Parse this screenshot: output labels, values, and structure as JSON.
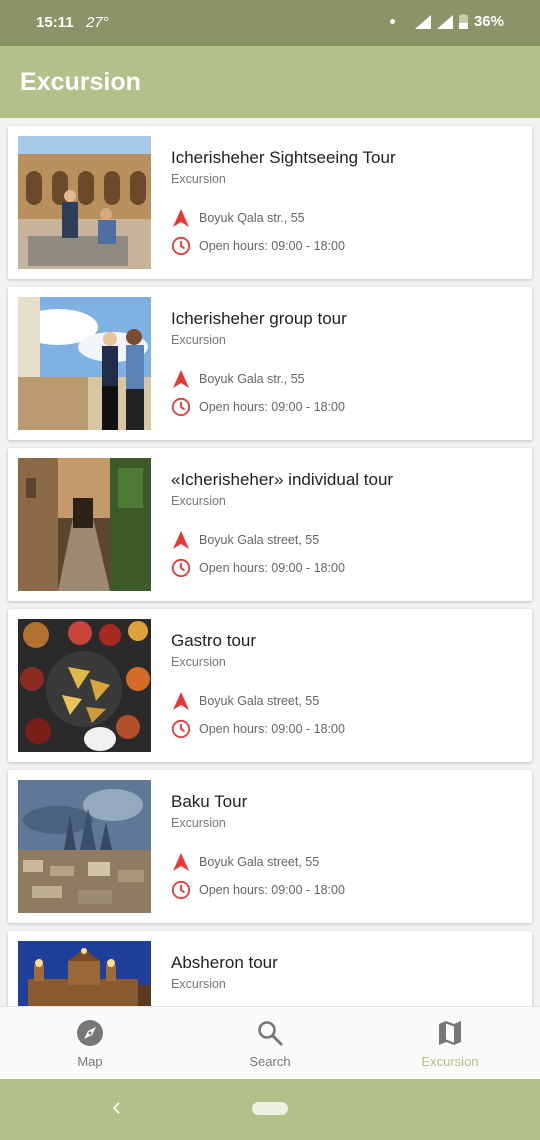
{
  "status_bar": {
    "time": "15:11",
    "temperature": "27°",
    "battery": "36%"
  },
  "app_bar": {
    "title": "Excursion"
  },
  "tours": [
    {
      "title": "Icherisheher Sightseeing Tour",
      "category": "Excursion",
      "address": "Boyuk Qala str., 55",
      "hours": "Open hours: 09:00 - 18:00",
      "image": "old-city-courtyard"
    },
    {
      "title": "Icherisheher group tour",
      "category": "Excursion",
      "address": "Boyuk Gala str., 55",
      "hours": "Open hours: 09:00 - 18:00",
      "image": "tourists-sky"
    },
    {
      "title": "«Icherisheher» individual tour",
      "category": "Excursion",
      "address": "Boyuk Gala street, 55",
      "hours": "Open hours: 09:00 - 18:00",
      "image": "narrow-street"
    },
    {
      "title": "Gastro tour",
      "category": "Excursion",
      "address": "Boyuk Gala street, 55",
      "hours": "Open hours: 09:00 - 18:00",
      "image": "sweets-table"
    },
    {
      "title": "Baku Tour",
      "category": "Excursion",
      "address": "Boyuk Gala street, 55",
      "hours": "Open hours: 09:00 - 18:00",
      "image": "city-skyline"
    },
    {
      "title": "Absheron tour",
      "category": "Excursion",
      "image": "fortress-night"
    }
  ],
  "bottom_nav": [
    {
      "label": "Map",
      "icon": "compass-icon",
      "active": false
    },
    {
      "label": "Search",
      "icon": "search-icon",
      "active": false
    },
    {
      "label": "Excursion",
      "icon": "map-icon",
      "active": true
    }
  ],
  "colors": {
    "accent": "#b4c089",
    "status_bar": "#8b9468",
    "pin": "#e53935"
  }
}
